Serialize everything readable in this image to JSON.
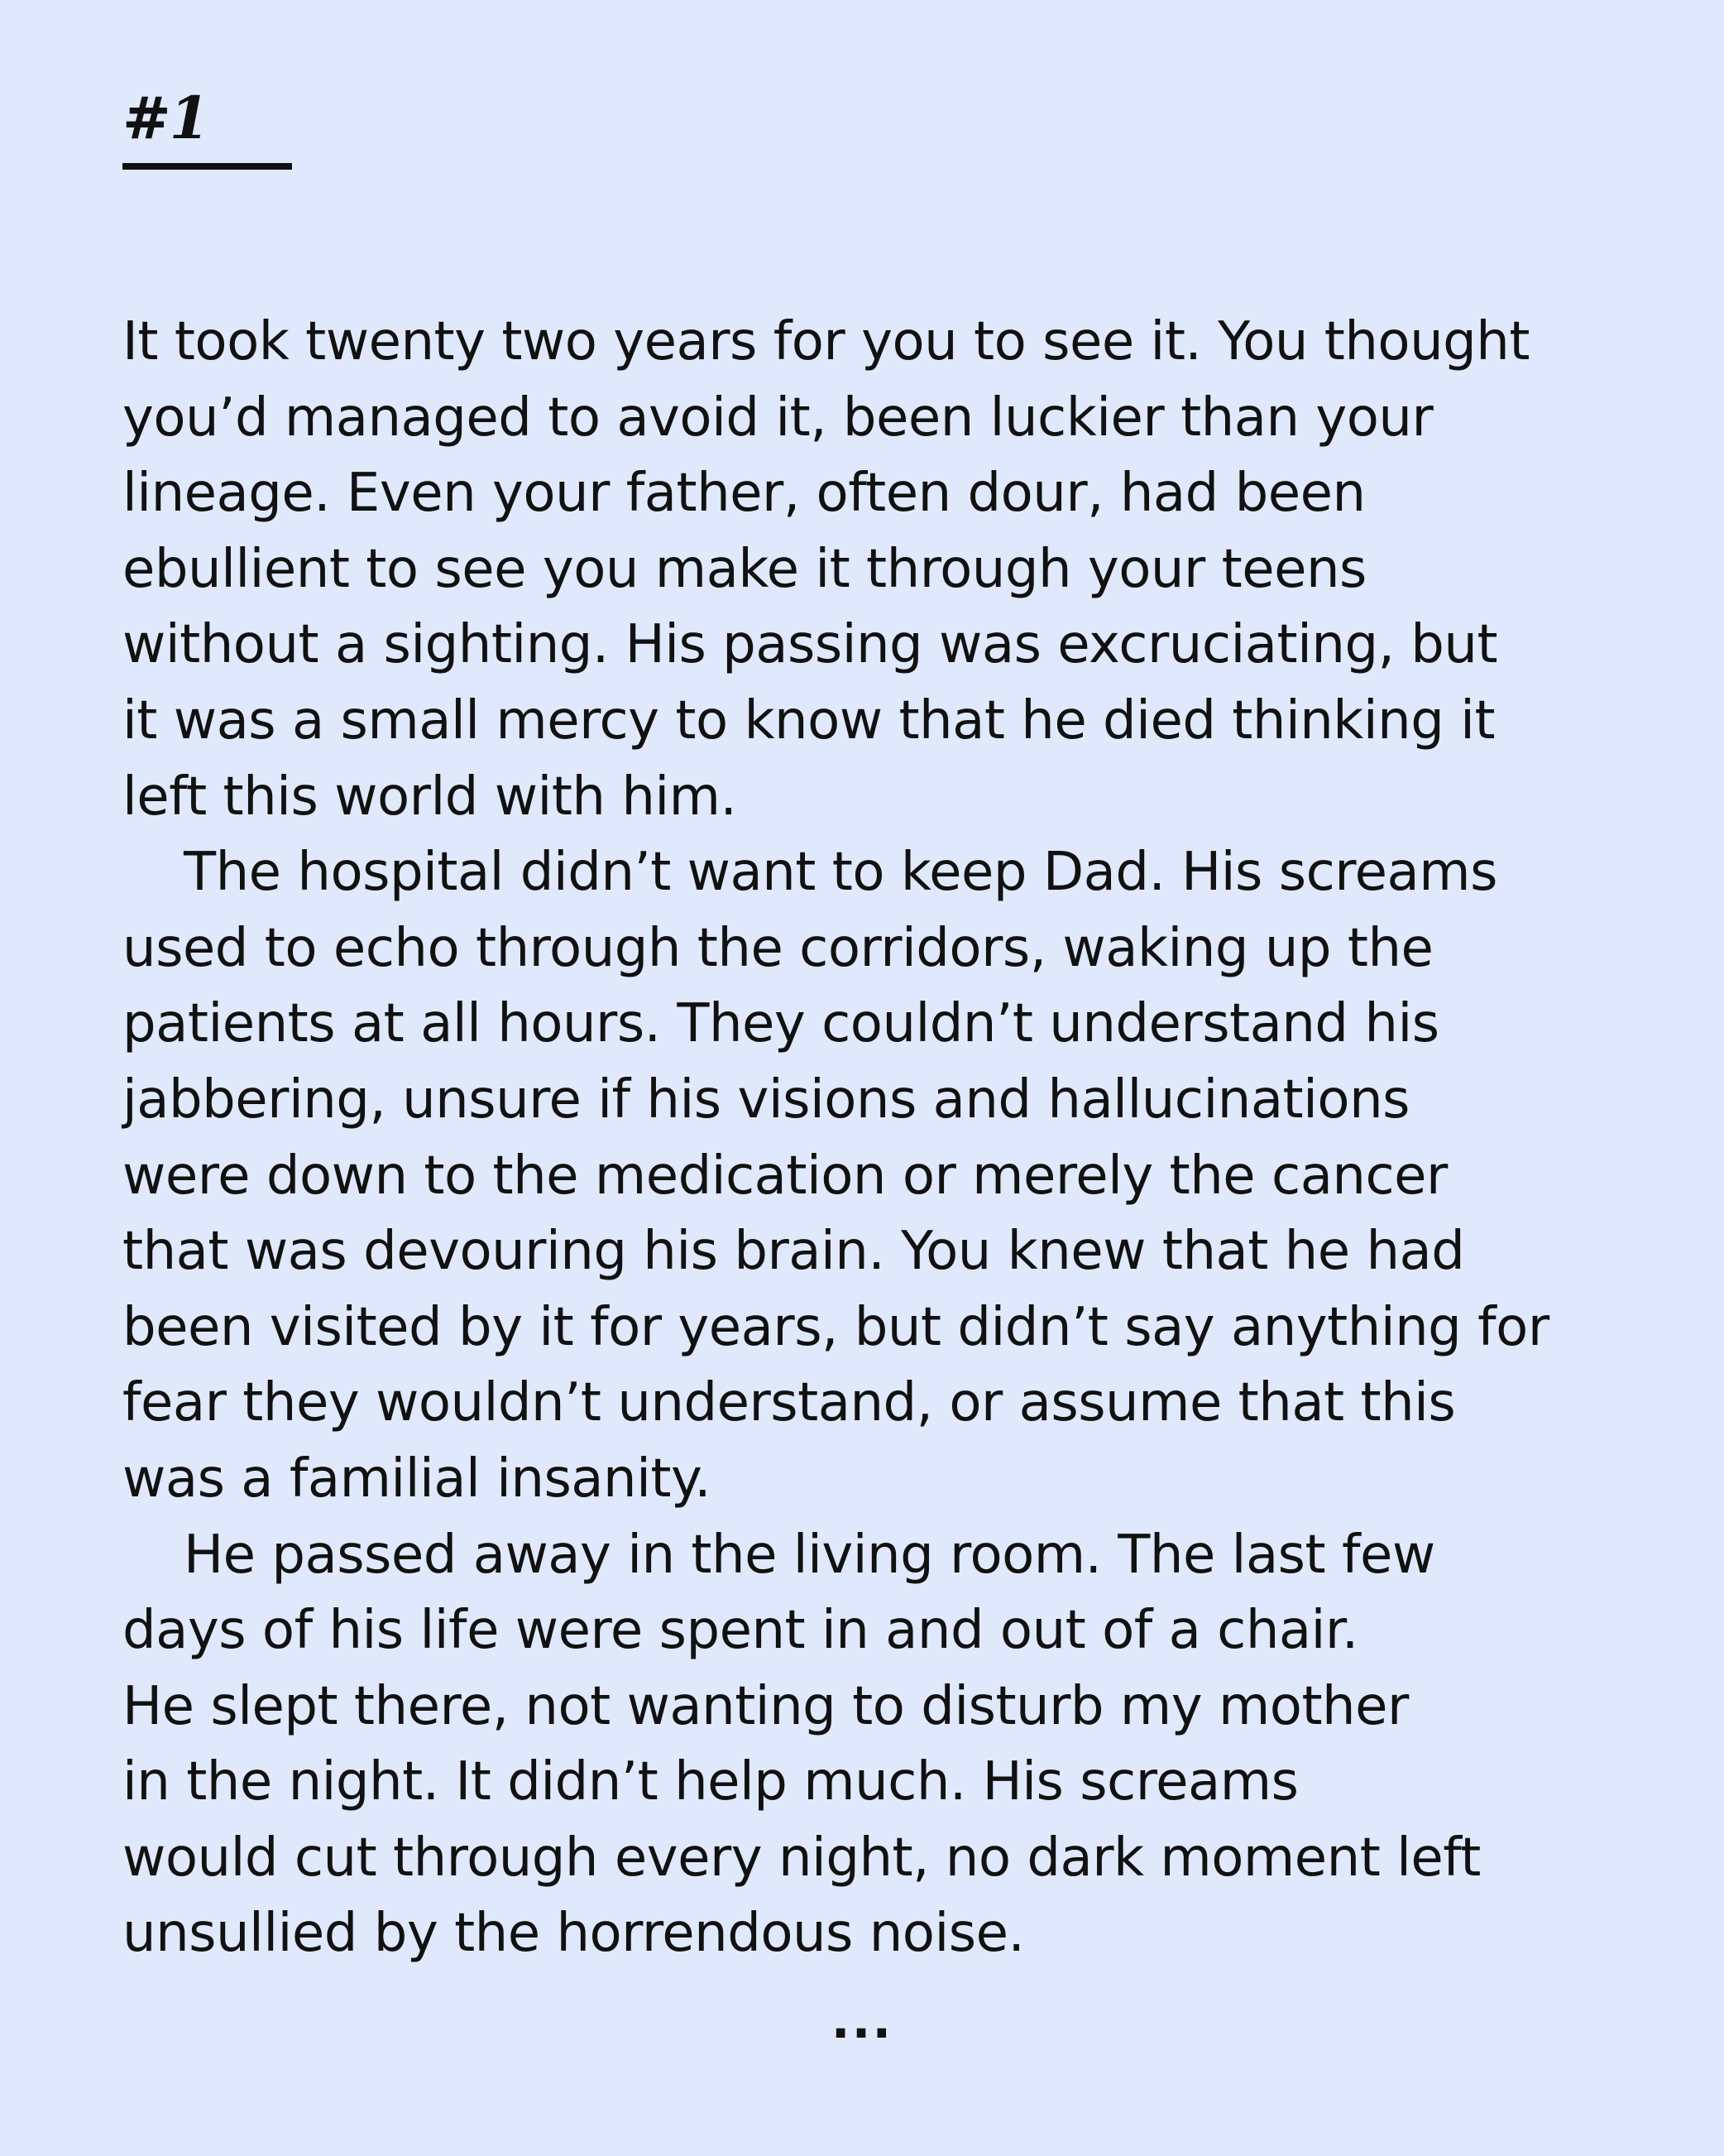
{
  "chapter": {
    "number": "#1"
  },
  "story": {
    "lines": [
      "It took twenty two years for you to see it. You thought",
      "you’d managed to avoid it, been luckier than your",
      "lineage. Even your father, often dour, had been",
      "ebullient to see you make it through your teens",
      "without a sighting. His passing was excruciating, but",
      "it was a small mercy to know that he died thinking it",
      "left this world with him.",
      "The hospital didn’t want to keep Dad. His screams",
      "used to echo through the corridors, waking up the",
      "patients at all hours. They couldn’t understand his",
      "jabbering, unsure if his visions and hallucinations",
      "were down to the medication or merely the cancer",
      "that was devouring his brain. You knew that he had",
      "been visited by it for years, but didn’t say anything for",
      "fear they wouldn’t understand, or assume that this",
      "was a familial insanity.",
      "He passed away in the living room. The last few",
      "days of his life were spent in and out of a chair.",
      "He slept there, not wanting to disturb my mother",
      "in the night. It didn’t help much. His screams",
      "would cut through every night, no dark moment left",
      "unsullied by the horrendous noise."
    ],
    "continuation": "..."
  }
}
